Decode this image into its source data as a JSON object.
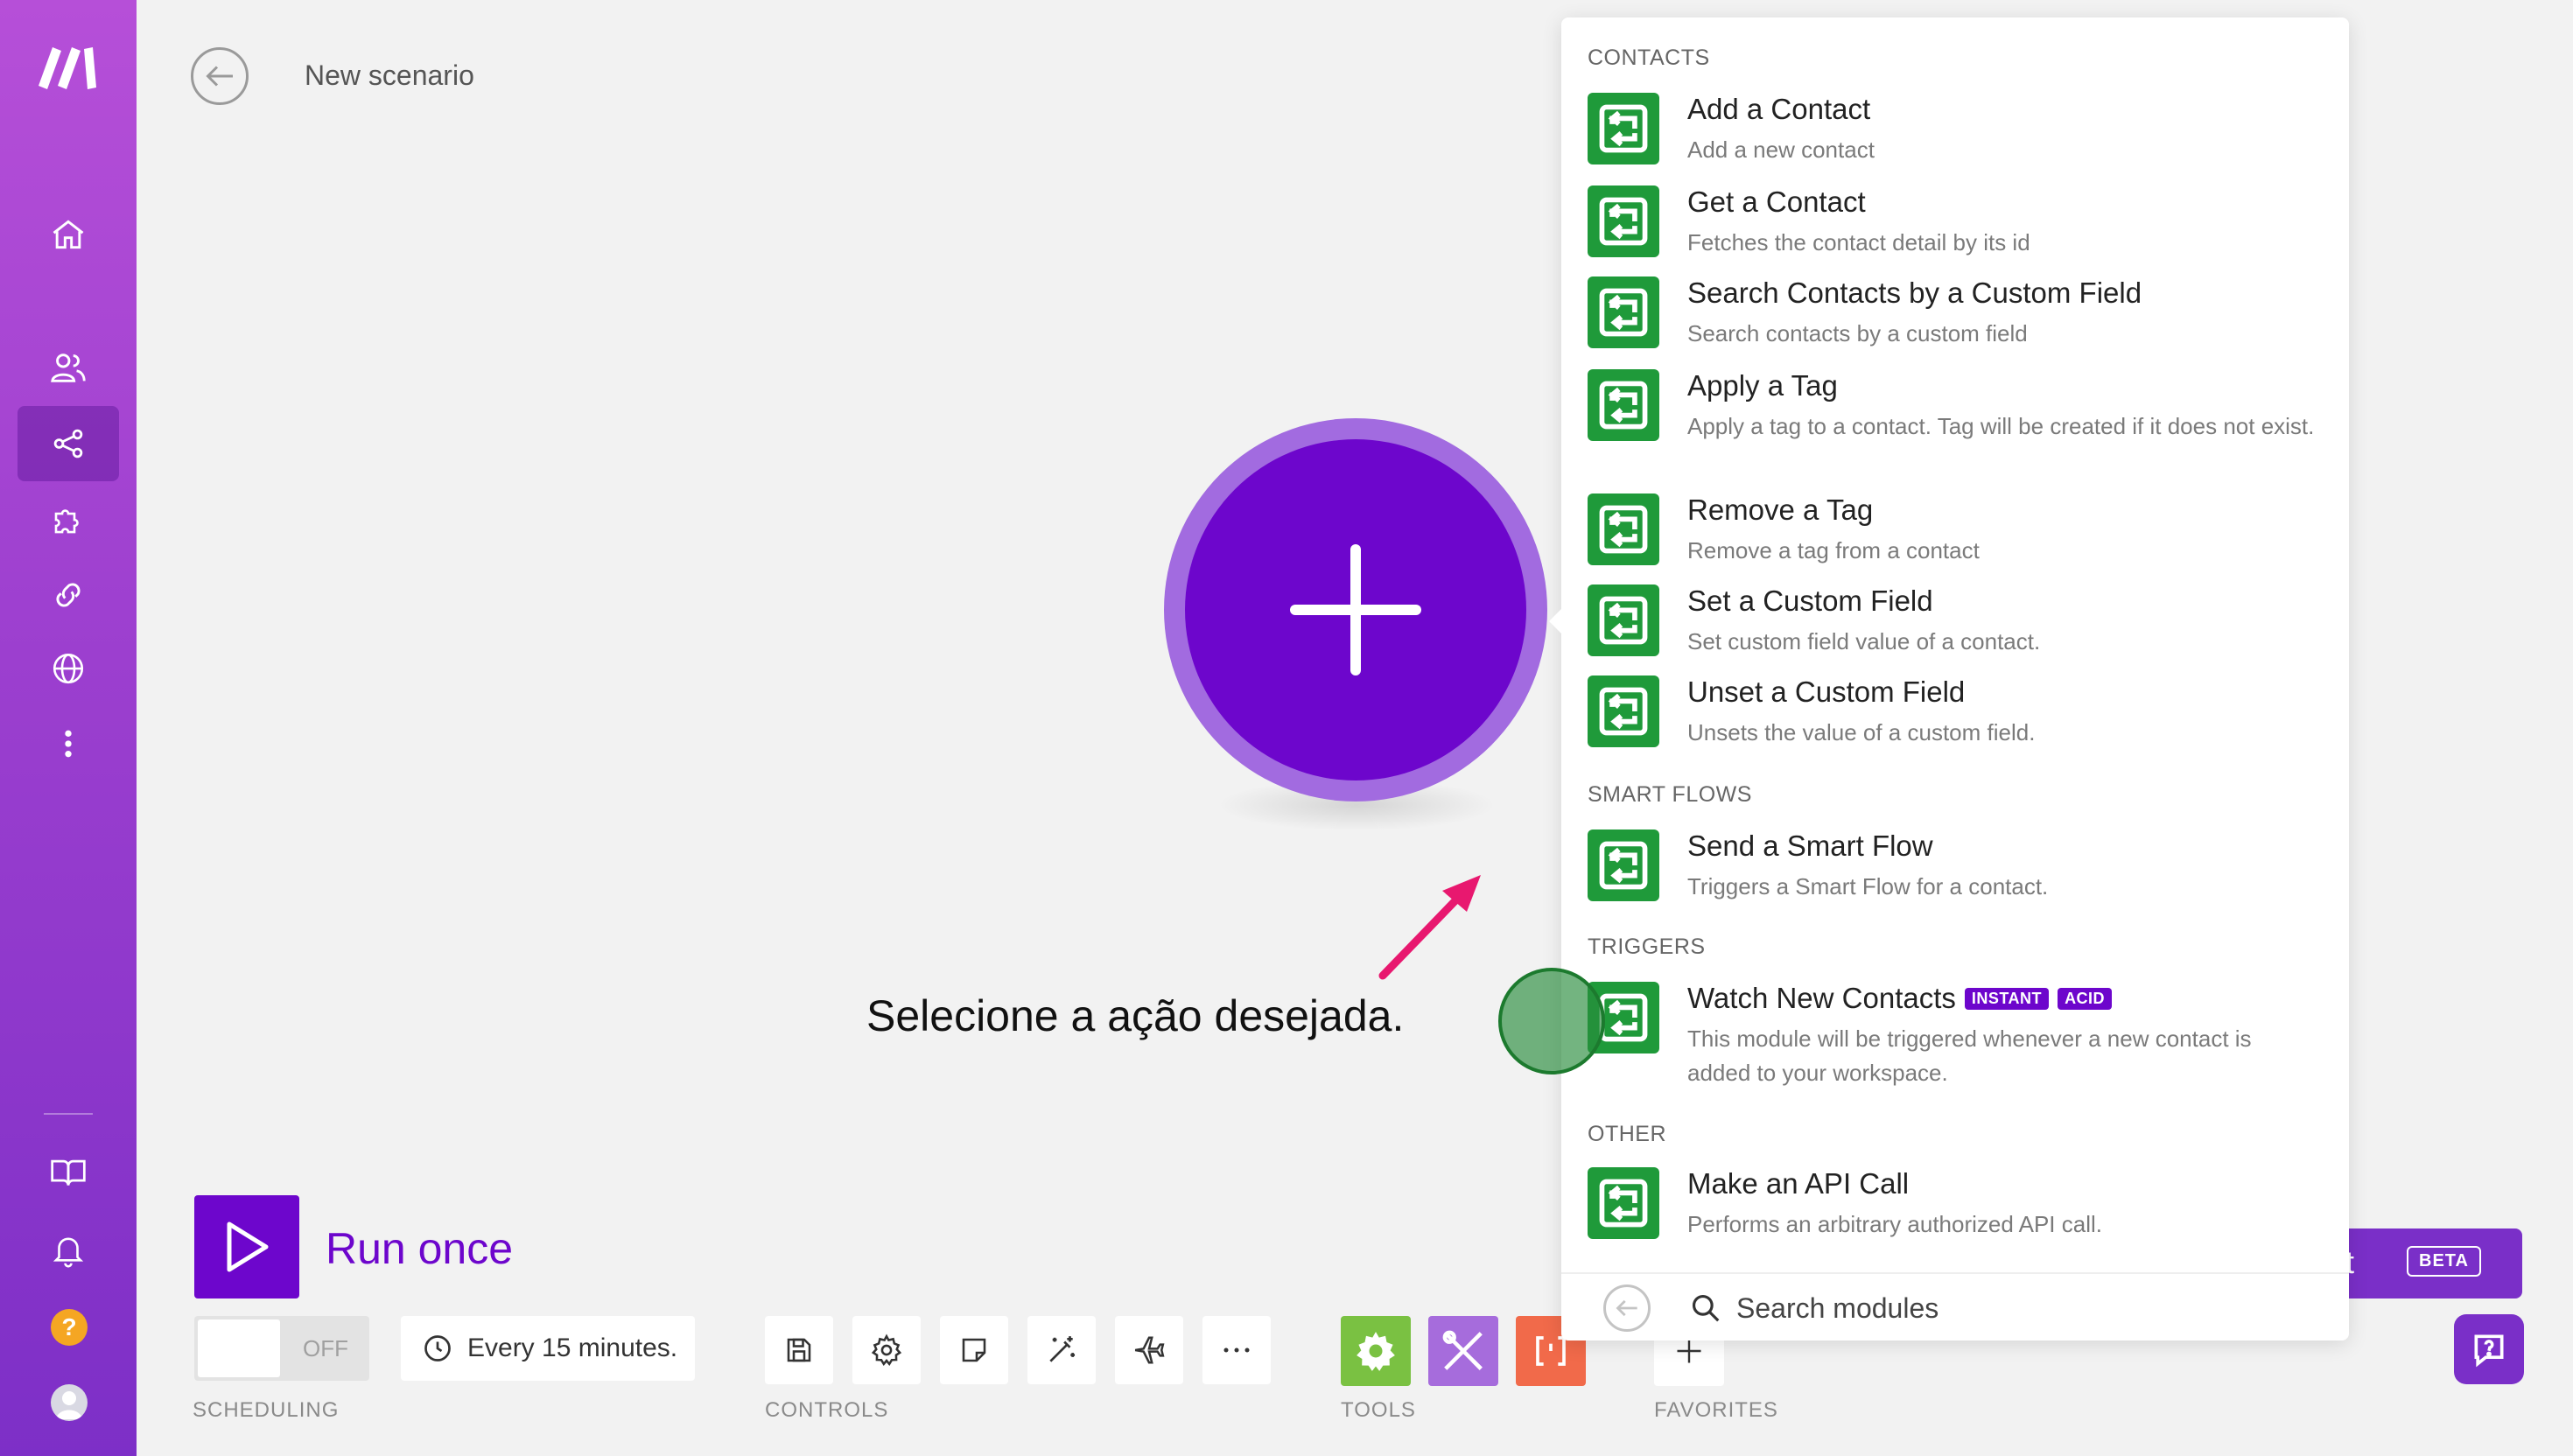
{
  "header": {
    "title": "New scenario"
  },
  "canvas": {
    "annotation": "Selecione a ação desejada."
  },
  "run": {
    "label": "Run once"
  },
  "toolbar": {
    "scheduling_label": "SCHEDULING",
    "toggle_state": "OFF",
    "schedule": "Every 15 minutes.",
    "controls_label": "CONTROLS",
    "tools_label": "TOOLS",
    "favorites_label": "FAVORITES",
    "tools": [
      {
        "name": "flow-control",
        "color": "#7ac142"
      },
      {
        "name": "tools",
        "color": "#a66cdc"
      },
      {
        "name": "text-parser",
        "color": "#f16a4a"
      }
    ]
  },
  "ai_button": {
    "label": "nt",
    "badge": "BETA"
  },
  "panel": {
    "sections": [
      {
        "title": "CONTACTS",
        "items": [
          {
            "title": "Add a Contact",
            "desc": "Add a new contact"
          },
          {
            "title": "Get a Contact",
            "desc": "Fetches the contact detail by its id"
          },
          {
            "title": "Search Contacts by a Custom Field",
            "desc": "Search contacts by a custom field"
          },
          {
            "title": "Apply a Tag",
            "desc": "Apply a tag to a contact. Tag will be created if it does not exist."
          },
          {
            "title": "Remove a Tag",
            "desc": "Remove a tag from a contact"
          },
          {
            "title": "Set a Custom Field",
            "desc": "Set custom field value of a contact."
          },
          {
            "title": "Unset a Custom Field",
            "desc": "Unsets the value of a custom field."
          }
        ]
      },
      {
        "title": "SMART FLOWS",
        "items": [
          {
            "title": "Send a Smart Flow",
            "desc": "Triggers a Smart Flow for a contact."
          }
        ]
      },
      {
        "title": "TRIGGERS",
        "items": [
          {
            "title": "Watch New Contacts",
            "desc": "This module will be triggered whenever a new contact is added to your workspace.",
            "badges": [
              "INSTANT",
              "ACID"
            ]
          }
        ]
      },
      {
        "title": "OTHER",
        "items": [
          {
            "title": "Make an API Call",
            "desc": "Performs an arbitrary authorized API call."
          }
        ]
      }
    ],
    "search_placeholder": "Search modules"
  },
  "colors": {
    "brand": "#6d06cc",
    "app_icon": "#1f9a3a",
    "sidebar_top": "#b64fd8",
    "sidebar_bottom": "#7d2fc7"
  }
}
